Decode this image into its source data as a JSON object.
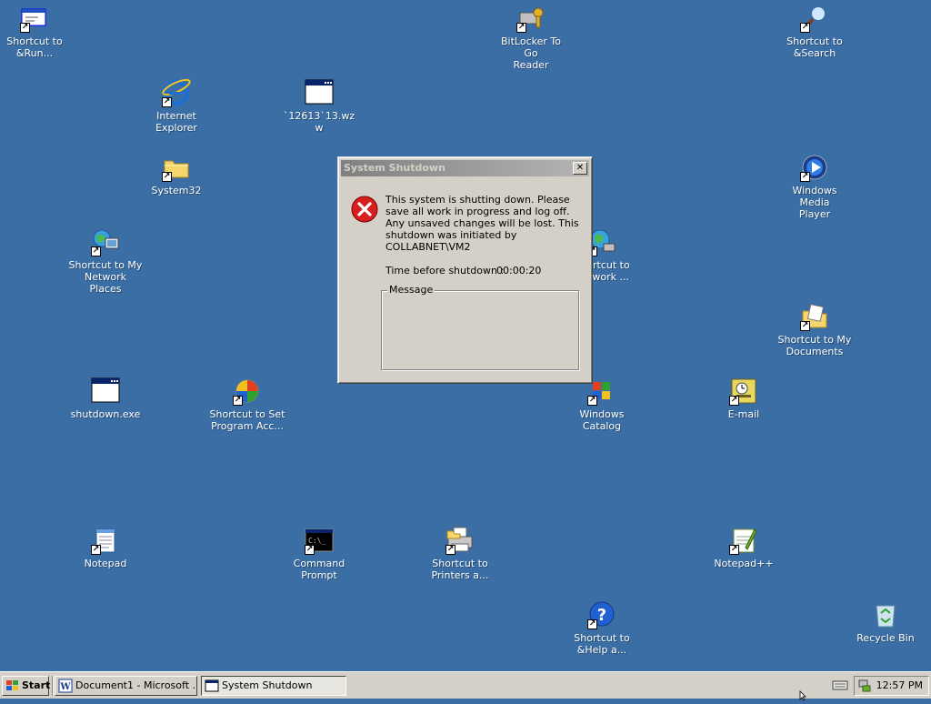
{
  "desktop": {
    "icons": [
      {
        "id": "run",
        "label": "Shortcut to\n&Run..."
      },
      {
        "id": "bitlocker",
        "label": "BitLocker To Go\nReader"
      },
      {
        "id": "search",
        "label": "Shortcut to\n&Search"
      },
      {
        "id": "ie",
        "label": "Internet\nExplorer"
      },
      {
        "id": "wzw",
        "label": "`12613`13.wz\nw"
      },
      {
        "id": "system32",
        "label": "System32"
      },
      {
        "id": "wmp",
        "label": "Windows Media\nPlayer"
      },
      {
        "id": "mynet",
        "label": "Shortcut to My\nNetwork Places"
      },
      {
        "id": "network2",
        "label": "Shortcut to\nNetwork ..."
      },
      {
        "id": "mydocs",
        "label": "Shortcut to My\nDocuments"
      },
      {
        "id": "shutdown",
        "label": "shutdown.exe"
      },
      {
        "id": "setprog",
        "label": "Shortcut to Set\nProgram Acc..."
      },
      {
        "id": "catalog",
        "label": "Windows\nCatalog"
      },
      {
        "id": "email",
        "label": "E-mail"
      },
      {
        "id": "notepad",
        "label": "Notepad"
      },
      {
        "id": "cmd",
        "label": "Command\nPrompt"
      },
      {
        "id": "printers",
        "label": "Shortcut to\nPrinters a..."
      },
      {
        "id": "notepadpp",
        "label": "Notepad++"
      },
      {
        "id": "help",
        "label": "Shortcut to\n&Help a..."
      },
      {
        "id": "recycle",
        "label": "Recycle Bin"
      }
    ]
  },
  "dialog": {
    "title": "System Shutdown",
    "close_glyph": "✕",
    "message": "This system is shutting down. Please save all work in progress and log off. Any unsaved changes will be lost. This shutdown was initiated by COLLABNET\\VM2",
    "time_label": "Time before shutdown :",
    "time_value": "00:00:20",
    "message_group_label": "Message",
    "message_text": ""
  },
  "taskbar": {
    "start_label": "Start",
    "buttons": [
      {
        "label": "Document1 - Microsoft ...",
        "icon": "word-icon",
        "active": false
      },
      {
        "label": "System Shutdown",
        "icon": "window-icon",
        "active": true
      }
    ],
    "clock": "12:57 PM"
  },
  "colors": {
    "desktop": "#3a6ea5",
    "dialog_face": "#d4d0c8",
    "inactive_title_start": "#808080",
    "inactive_title_end": "#b5b5b5",
    "error_red": "#d81e1e"
  }
}
